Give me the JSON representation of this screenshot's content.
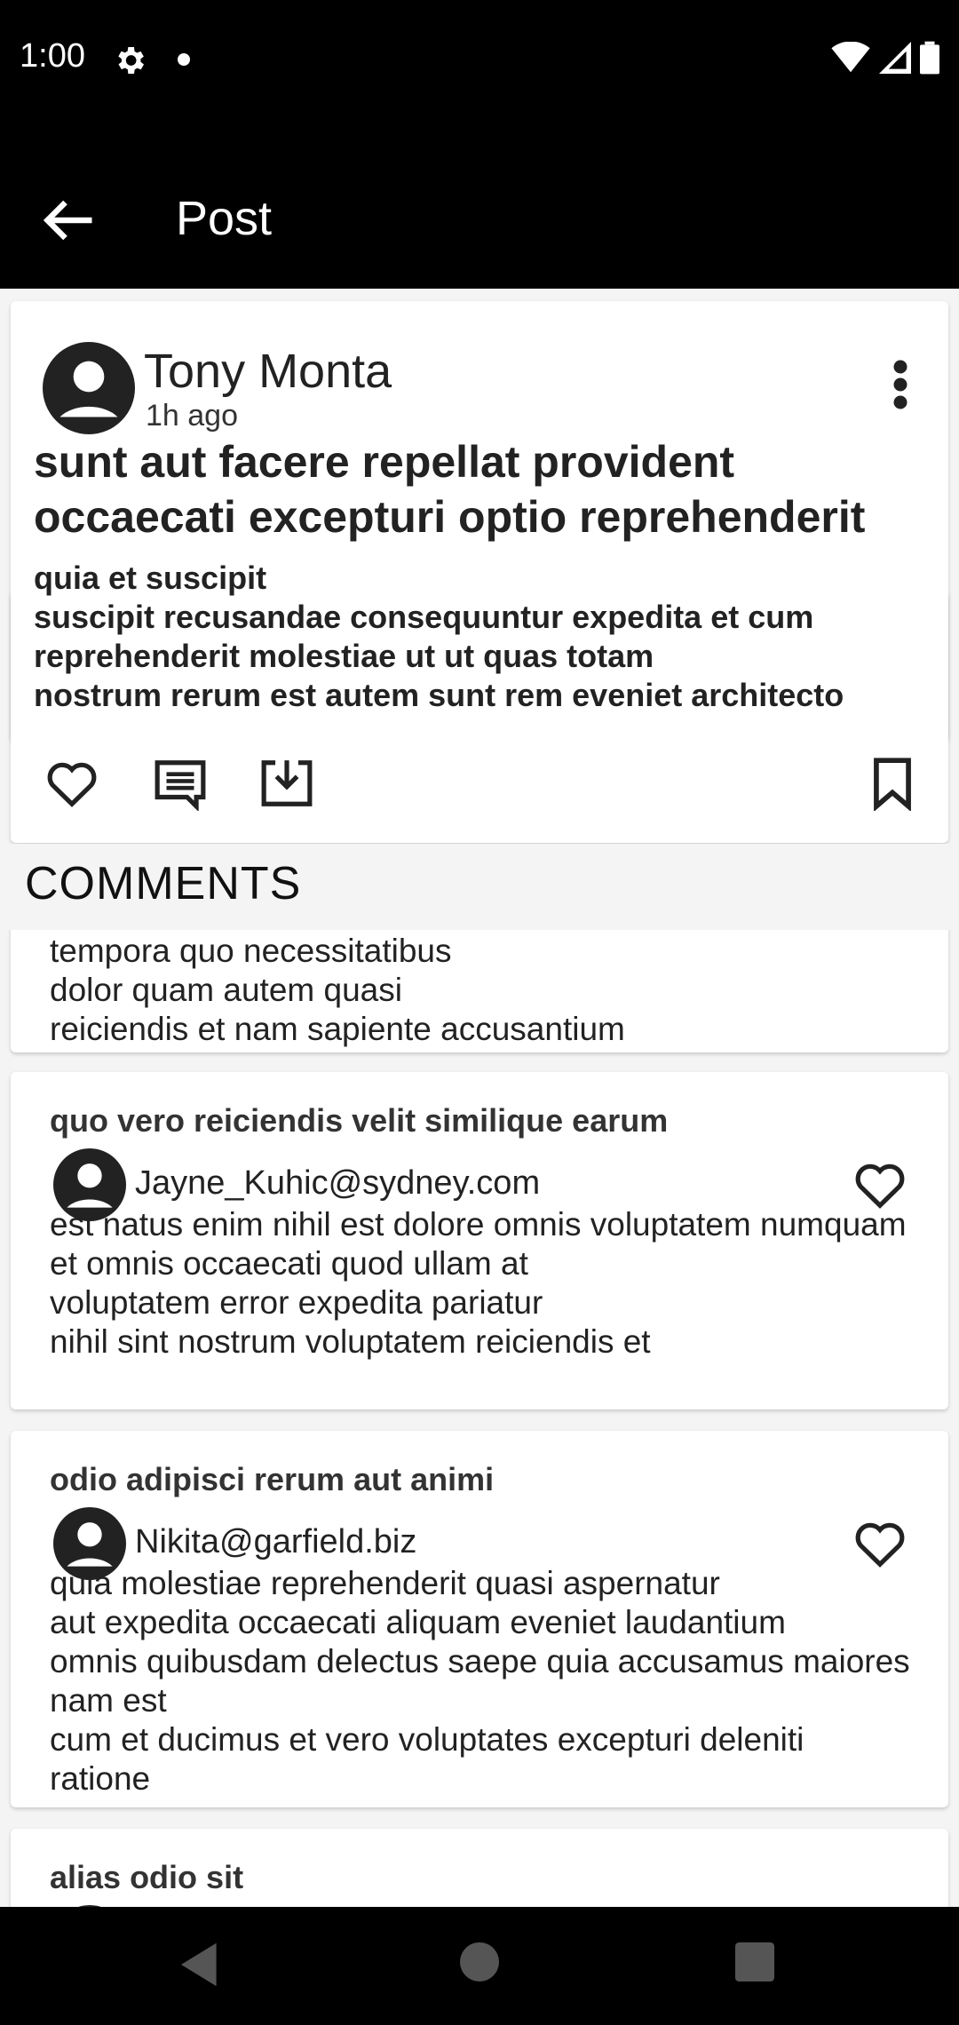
{
  "status": {
    "time": "1:00"
  },
  "appbar": {
    "title": "Post"
  },
  "post": {
    "author": "Tony Monta",
    "time": "1h ago",
    "title": "sunt aut facere repellat provident occaecati excepturi optio reprehenderit",
    "body": "quia et suscipit\nsuscipit recusandae consequuntur expedita et cum\nreprehenderit molestiae ut ut quas totam\nnostrum rerum est autem sunt rem eveniet architecto"
  },
  "comments": {
    "heading": "COMMENTS",
    "items": [
      {
        "title": "",
        "email": "",
        "body": "ipsam eos\ntempora quo necessitatibus\ndolor quam autem quasi\nreiciendis et nam sapiente accusantium"
      },
      {
        "title": "quo vero reiciendis velit similique earum",
        "email": "Jayne_Kuhic@sydney.com",
        "body": "est natus enim nihil est dolore omnis voluptatem numquam\net omnis occaecati quod ullam at\nvoluptatem error expedita pariatur\nnihil sint nostrum voluptatem reiciendis et"
      },
      {
        "title": "odio adipisci rerum aut animi",
        "email": "Nikita@garfield.biz",
        "body": "quia molestiae reprehenderit quasi aspernatur\naut expedita occaecati aliquam eveniet laudantium\nomnis quibusdam delectus saepe quia accusamus maiores nam est\ncum et ducimus et vero voluptates excepturi deleniti ratione"
      },
      {
        "title": "alias odio sit",
        "email": "",
        "body": ""
      }
    ]
  },
  "icons": {
    "back": "arrow-back-icon",
    "more": "more-vert-icon",
    "like": "heart-outline-icon",
    "comment": "comment-icon",
    "download": "download-icon",
    "bookmark": "bookmark-icon",
    "avatar": "account-circle-icon"
  }
}
